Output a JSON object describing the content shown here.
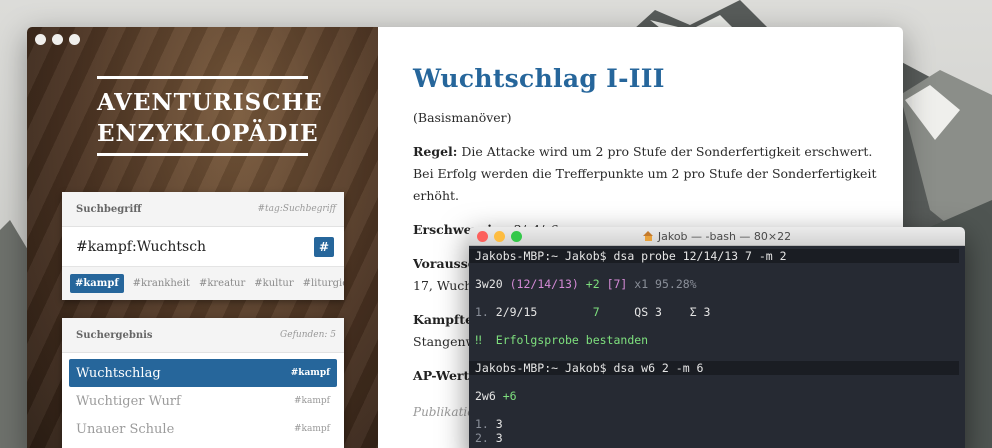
{
  "app": {
    "logo_line1": "AVENTURISCHE",
    "logo_line2": "ENZYKLOPÄDIE",
    "search_panel": {
      "title": "Suchbegriff",
      "hint": "#tag:Suchbegriff",
      "value": "#kampf:Wuchtsch",
      "hash_button": "#",
      "tags": [
        "#kampf",
        "#krankheit",
        "#kreatur",
        "#kultur",
        "#liturgie",
        "#"
      ]
    },
    "result_panel": {
      "title": "Suchergebnis",
      "count": "Gefunden: 5",
      "items": [
        {
          "name": "Wuchtschlag",
          "tag": "#kampf"
        },
        {
          "name": "Wuchtiger Wurf",
          "tag": "#kampf"
        },
        {
          "name": "Unauer Schule",
          "tag": "#kampf"
        }
      ]
    },
    "article": {
      "heading": "Wuchtschlag I-III",
      "subtitle": "(Basismanöver)",
      "regel_label": "Regel:",
      "regel_text": " Die Attacke wird um 2 pro Stufe der Sonderfertigkeit erschwert. Bei Erfolg werden die Trefferpunkte um 2 pro Stufe der Sonderfertigkeit erhöht.",
      "erschwernis_label": "Erschwernis:",
      "erschwernis_text": " –2/–4/–6",
      "vorauss_label": "Vorausse",
      "vorauss_text": "17, Wucht",
      "kampftec_label": "Kampftec",
      "kampftec_text": "Stangenwa",
      "ap_label": "AP-Wert:",
      "publikation": "Publikation"
    }
  },
  "terminal": {
    "title": "Jakob — -bash — 80×22",
    "prompt1": "Jakobs-MBP:~ Jakob$ dsa probe 12/14/13 7 -m 2",
    "r1_a": "3w20 ",
    "r1_b": "(12/14/13) ",
    "r1_c": "+2 ",
    "r1_d": "[7] ",
    "r1_e": "x1 95.28%",
    "r2_num": "1. ",
    "r2_a": "2/9/15",
    "r2_b": "7",
    "r2_c": "QS 3",
    "r2_d": "Σ 3",
    "success": "‼  Erfolgsprobe bestanden",
    "prompt2": "Jakobs-MBP:~ Jakob$ dsa w6 2 -m 6",
    "r3_a": "2w6 ",
    "r3_b": "+6",
    "l1_num": "1. ",
    "l1_val": "3",
    "l2_num": "2. ",
    "l2_val": "3"
  },
  "colors": {
    "accent": "#26669b",
    "terminal_bg": "#262a33"
  }
}
